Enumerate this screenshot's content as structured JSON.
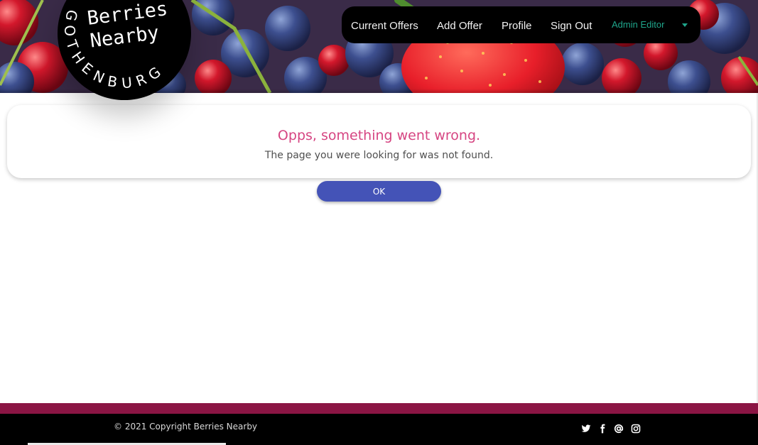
{
  "logo": {
    "title": "Berries\nNearby",
    "city": "GOTHENBURG"
  },
  "nav": {
    "links": [
      "Current Offers",
      "Add Offer",
      "Profile",
      "Sign Out"
    ],
    "user": "Admin Editor"
  },
  "error": {
    "title": "Opps, something went wrong.",
    "message": "The page you were looking for was not found.",
    "ok_label": "OK"
  },
  "footer": {
    "copyright": "© 2021 Copyright Berries Nearby",
    "social_icons": [
      "twitter-icon",
      "facebook-icon",
      "email-icon",
      "instagram-icon"
    ]
  },
  "colors": {
    "accent_pink": "#d64582",
    "button_blue": "#4453b7",
    "footer_stripe": "#8b1544",
    "user_green": "#1fa58b"
  }
}
